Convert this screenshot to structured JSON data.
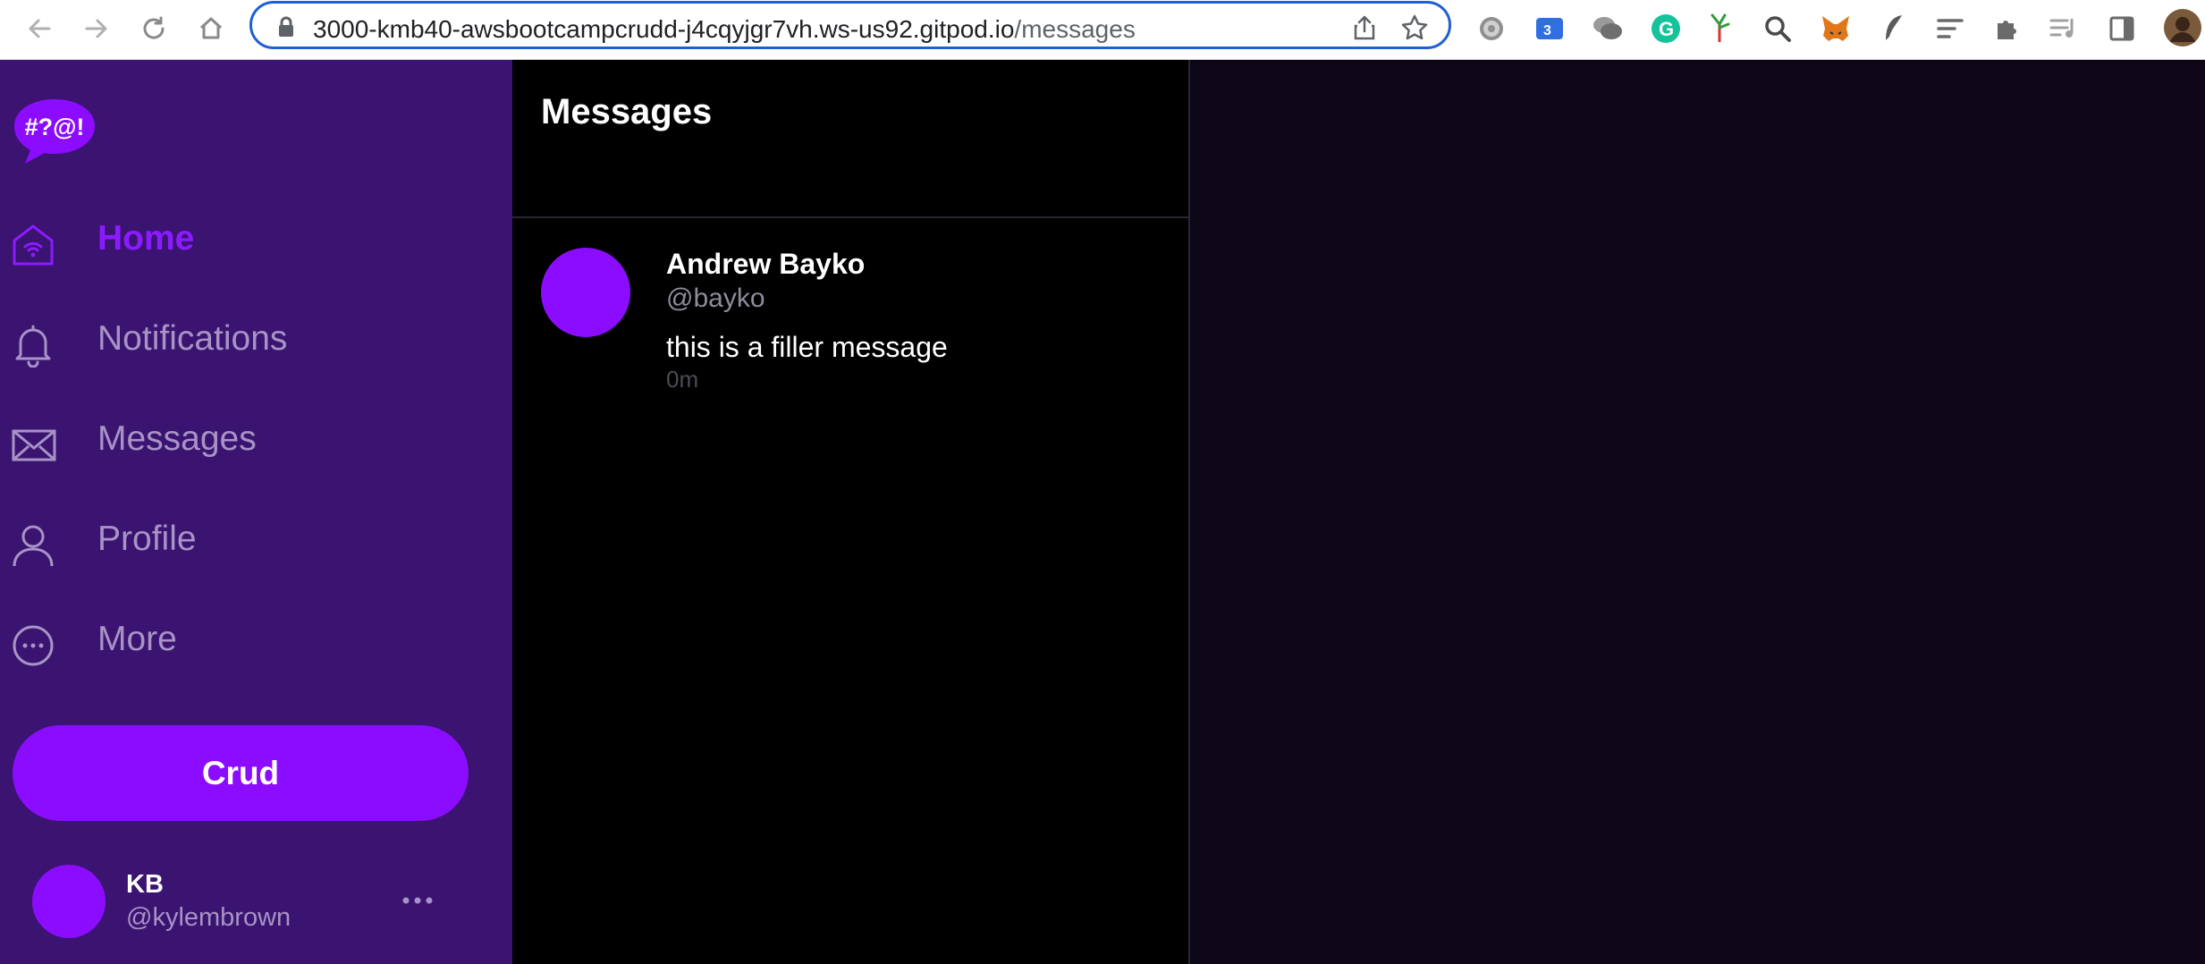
{
  "browser": {
    "url_host": "3000-kmb40-awsbootcampcrudd-j4cqyjgr7vh.ws-us92.gitpod.io",
    "url_path": "/messages",
    "nav_icons": [
      "back-icon",
      "forward-icon",
      "reload-icon",
      "home-icon"
    ],
    "extension_icons": [
      "gear-extension-icon",
      "translate-extension-icon",
      "chat-extension-icon",
      "grammarly-icon",
      "tools-extension-icon",
      "search-extension-icon",
      "metamask-fox-icon",
      "feather-extension-icon",
      "list-extension-icon",
      "puzzle-extensions-icon",
      "media-queue-icon",
      "side-panel-icon",
      "profile-avatar"
    ]
  },
  "app": {
    "logo_text": "#?@!",
    "accent_color": "#8c0cff",
    "sidebar_color": "#3a1470"
  },
  "sidebar": {
    "items": [
      {
        "label": "Home",
        "icon": "home-wifi-icon",
        "active": true
      },
      {
        "label": "Notifications",
        "icon": "bell-icon",
        "active": false
      },
      {
        "label": "Messages",
        "icon": "envelope-icon",
        "active": false
      },
      {
        "label": "Profile",
        "icon": "person-icon",
        "active": false
      },
      {
        "label": "More",
        "icon": "more-circle-icon",
        "active": false
      }
    ],
    "crud_button": "Crud",
    "user": {
      "display_name": "KB",
      "handle": "@kylembrown"
    }
  },
  "main": {
    "title": "Messages",
    "messages": [
      {
        "display_name": "Andrew Bayko",
        "handle": "@bayko",
        "message": "this is a filler message",
        "time": "0m"
      }
    ]
  }
}
